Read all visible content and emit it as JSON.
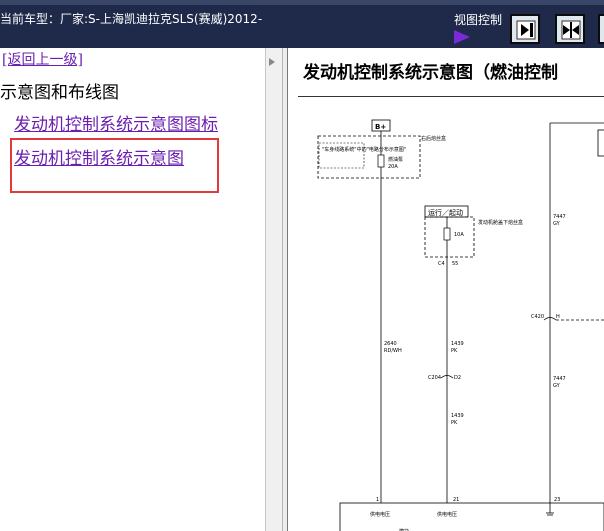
{
  "header": {
    "vehicle": "当前车型：厂家:S-上海凯迪拉克SLS(赛威)2012-",
    "view_control_label": "视图控制",
    "view_buttons": [
      "forward-icon",
      "split-icon",
      "wrap-icon"
    ]
  },
  "sidebar": {
    "back_link": "[返回上一级]",
    "section_title": "示意图和布线图",
    "links": [
      "发动机控制系统示意图图标",
      "发动机控制系统示意图"
    ]
  },
  "main": {
    "title": "发动机控制系统示意图（燃油控制",
    "diagram": {
      "bplus": "B+",
      "note1": "\"车身线路系统\"中的\"电路分布示意图\"",
      "fuse_box_right": "右后熔丝盒",
      "fuse_pump": "燃油泵",
      "fuse_pump_amp": "20A",
      "run_start": "运行／起动",
      "engine_fuse_box": "发动机舱盖下熔丝盒",
      "fuse_10a": "10A",
      "c4": "C4",
      "pin55": "55",
      "c7447_top": "7447",
      "gy_top": "GY",
      "c420": "C420",
      "h": "H",
      "wire_2640": "2640",
      "rd_wh": "RD/WH",
      "wire_1439a": "1439",
      "pk_a": "PK",
      "c204": "C204",
      "d2": "D2",
      "c7447_mid": "7447",
      "gy_mid": "GY",
      "wire_1439b": "1439",
      "pk_b": "PK",
      "pin1": "1",
      "pin21": "21",
      "pin23": "23",
      "power_a": "供电电压",
      "power_b": "供电电压",
      "module": "模块",
      "pin25": "25",
      "pin5": "5",
      "pin17": "17",
      "pin6": "6",
      "w1850": "1850",
      "bk": "BK",
      "w2500a": "2500",
      "tn_bk": "TN/BK",
      "w2501": "2501",
      "tn": "TN",
      "w2500b": "2500",
      "tn_bk2": "TN/BK"
    }
  }
}
